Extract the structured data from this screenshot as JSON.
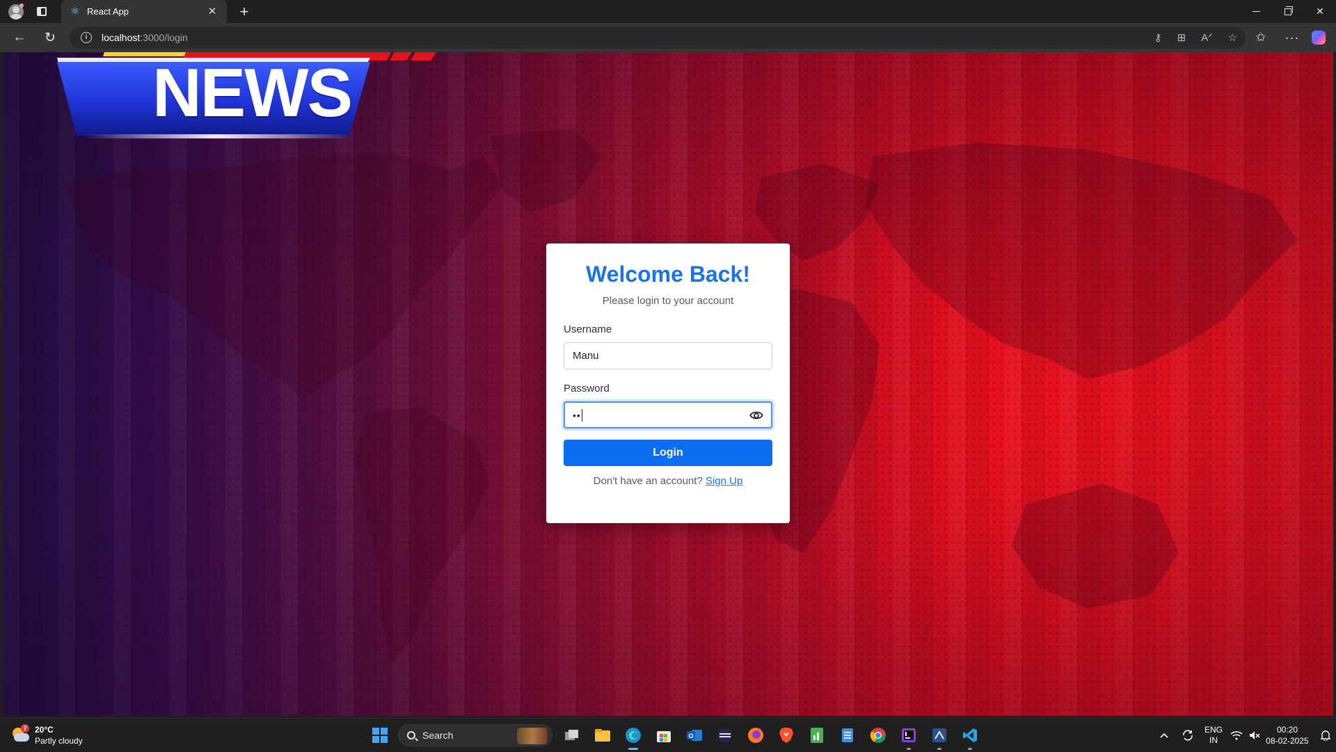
{
  "browser": {
    "tab_title": "React App",
    "url_host": "localhost",
    "url_path": ":3000/login"
  },
  "banner": {
    "logo_text": "NEWS"
  },
  "login": {
    "title": "Welcome Back!",
    "subtitle": "Please login to your account",
    "username_label": "Username",
    "username_value": "Manu",
    "password_label": "Password",
    "password_masked": "••",
    "button_label": "Login",
    "signup_prompt": "Don't have an account?",
    "signup_link": "Sign Up"
  },
  "taskbar": {
    "weather_temp": "20°C",
    "weather_desc": "Partly cloudy",
    "weather_badge": "7",
    "search_label": "Search",
    "lang_top": "ENG",
    "lang_bottom": "IN",
    "time": "00:20",
    "date": "08-02-2025"
  },
  "colors": {
    "accent": "#1a73e8",
    "button": "#0b6ef0",
    "background_red": "#f0101c",
    "background_purple": "#24104a"
  },
  "icons": {
    "tab": "react-icon",
    "eye": "eye-icon",
    "start": "windows-start-icon"
  }
}
